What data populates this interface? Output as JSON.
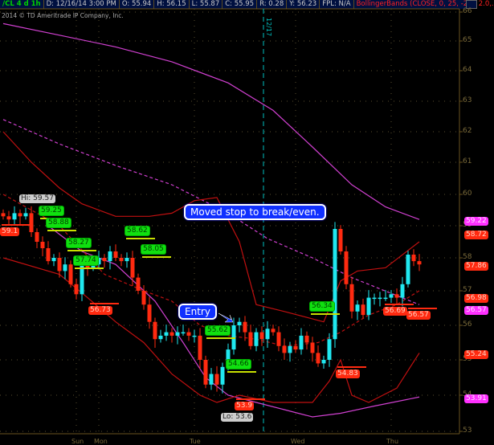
{
  "header": {
    "symbol": "/CL 4 d 1h",
    "date": "D: 12/16/14 3:00 PM",
    "open": "O: 55.94",
    "high": "H: 56.15",
    "low": "L: 55.87",
    "close": "C: 55.95",
    "range": "R: 0.28",
    "y": "Y: 56.23",
    "fpl": "FPL: N/A",
    "study": "BollingerBands (CLOSE, 0, 25, -2.0, 2.0,..."
  },
  "copyright": "2014 © TD Ameritrade IP Company, Inc.",
  "vline_label": "12/17",
  "chart_data": {
    "type": "candlestick",
    "yticks": [
      {
        "v": "66"
      },
      {
        "v": "65"
      },
      {
        "v": "64"
      },
      {
        "v": "63"
      },
      {
        "v": "62"
      },
      {
        "v": "61"
      },
      {
        "v": "60"
      },
      {
        "v": "59"
      },
      {
        "v": "58"
      },
      {
        "v": "57"
      },
      {
        "v": "56"
      },
      {
        "v": "55"
      },
      {
        "v": "54"
      },
      {
        "v": "53"
      }
    ],
    "days": [
      {
        "label": "Sun",
        "i": 13
      },
      {
        "label": "Mon",
        "i": 17
      },
      {
        "label": "Tue",
        "i": 34
      },
      {
        "label": "Wed",
        "i": 52
      },
      {
        "label": "Thu",
        "i": 69
      }
    ],
    "first_open": 59.4,
    "closes": [
      59.3,
      59.2,
      59.4,
      59.3,
      59.4,
      58.8,
      58.5,
      58.3,
      57.9,
      58.0,
      57.6,
      57.8,
      57.2,
      56.9,
      57.8,
      57.7,
      57.8,
      58.0,
      57.9,
      58.2,
      58.0,
      57.9,
      58.0,
      57.4,
      57.0,
      56.6,
      56.1,
      55.6,
      55.7,
      55.8,
      55.7,
      55.8,
      55.8,
      55.7,
      55.7,
      55.0,
      54.3,
      54.6,
      54.3,
      54.8,
      55.3,
      56.0,
      56.1,
      55.8,
      55.4,
      55.8,
      55.6,
      55.9,
      55.8,
      55.4,
      55.2,
      55.4,
      55.3,
      55.7,
      55.5,
      55.2,
      54.9,
      55.0,
      55.6,
      58.9,
      58.2,
      57.2,
      56.4,
      56.6,
      56.3,
      56.8,
      56.8,
      56.8,
      56.8,
      56.9,
      56.8,
      57.2,
      58.1,
      57.9,
      57.8
    ],
    "lines": [
      {
        "name": "magenta-upper",
        "color": "#d040d0",
        "dash": false,
        "pts": [
          [
            0,
            65.6
          ],
          [
            10,
            65.2
          ],
          [
            20,
            64.8
          ],
          [
            30,
            64.3
          ],
          [
            40,
            63.6
          ],
          [
            48,
            62.7
          ],
          [
            55,
            61.5
          ],
          [
            62,
            60.3
          ],
          [
            68,
            59.6
          ],
          [
            74,
            59.2
          ]
        ]
      },
      {
        "name": "magenta-mid",
        "color": "#d040d0",
        "dash": true,
        "pts": [
          [
            0,
            62.4
          ],
          [
            10,
            61.6
          ],
          [
            20,
            60.9
          ],
          [
            30,
            60.3
          ],
          [
            40,
            59.4
          ],
          [
            47,
            58.6
          ],
          [
            55,
            58.0
          ],
          [
            62,
            57.4
          ],
          [
            74,
            56.6
          ]
        ]
      },
      {
        "name": "magenta-lower",
        "color": "#d040d0",
        "dash": false,
        "pts": [
          [
            8,
            59.0
          ],
          [
            14,
            58.2
          ],
          [
            20,
            57.8
          ],
          [
            27,
            56.7
          ],
          [
            32,
            55.5
          ],
          [
            36,
            54.5
          ],
          [
            40,
            54.0
          ],
          [
            45,
            53.8
          ],
          [
            50,
            53.6
          ],
          [
            55,
            53.4
          ],
          [
            60,
            53.5
          ],
          [
            66,
            53.7
          ],
          [
            74,
            53.95
          ]
        ]
      },
      {
        "name": "bb-upper",
        "color": "#c01010",
        "dash": false,
        "pts": [
          [
            0,
            62.0
          ],
          [
            5,
            61.0
          ],
          [
            10,
            60.2
          ],
          [
            14,
            59.7
          ],
          [
            20,
            59.3
          ],
          [
            26,
            59.3
          ],
          [
            30,
            59.4
          ],
          [
            34,
            59.8
          ],
          [
            38,
            59.9
          ],
          [
            42,
            58.5
          ],
          [
            45,
            56.6
          ],
          [
            50,
            56.4
          ],
          [
            57,
            56.1
          ],
          [
            60,
            57.3
          ],
          [
            63,
            57.6
          ],
          [
            68,
            57.7
          ],
          [
            74,
            58.5
          ]
        ]
      },
      {
        "name": "bb-mid",
        "color": "#c01010",
        "dash": true,
        "pts": [
          [
            0,
            60.0
          ],
          [
            10,
            59.0
          ],
          [
            18,
            57.5
          ],
          [
            25,
            57.0
          ],
          [
            30,
            56.7
          ],
          [
            35,
            56.0
          ],
          [
            40,
            55.7
          ],
          [
            45,
            55.6
          ],
          [
            50,
            55.4
          ],
          [
            56,
            55.5
          ],
          [
            60,
            55.8
          ],
          [
            65,
            56.3
          ],
          [
            70,
            56.6
          ],
          [
            74,
            57.0
          ]
        ]
      },
      {
        "name": "bb-lower",
        "color": "#c01010",
        "dash": false,
        "pts": [
          [
            0,
            58.0
          ],
          [
            10,
            57.5
          ],
          [
            15,
            56.8
          ],
          [
            20,
            56.1
          ],
          [
            25,
            55.5
          ],
          [
            30,
            54.6
          ],
          [
            35,
            54.0
          ],
          [
            38,
            53.8
          ],
          [
            42,
            54.0
          ],
          [
            48,
            53.8
          ],
          [
            55,
            53.8
          ],
          [
            58,
            54.4
          ],
          [
            60,
            55.0
          ],
          [
            62,
            54.0
          ],
          [
            65,
            53.8
          ],
          [
            70,
            54.2
          ],
          [
            74,
            55.2
          ]
        ]
      }
    ]
  },
  "price_labels": [
    {
      "text": "59.25",
      "kind": "g"
    },
    {
      "text": "58.88",
      "kind": "g"
    },
    {
      "text": "58.27",
      "kind": "g"
    },
    {
      "text": "57.74",
      "kind": "g"
    },
    {
      "text": "58.62",
      "kind": "g"
    },
    {
      "text": "58.05",
      "kind": "g"
    },
    {
      "text": "55.62",
      "kind": "g"
    },
    {
      "text": "54.66",
      "kind": "g"
    },
    {
      "text": "56.34",
      "kind": "g"
    },
    {
      "text": "59.1",
      "kind": "r"
    },
    {
      "text": "56.73",
      "kind": "r"
    },
    {
      "text": "53.9",
      "kind": "r"
    },
    {
      "text": "54.83",
      "kind": "r"
    },
    {
      "text": "56.69",
      "kind": "r"
    },
    {
      "text": "56.57",
      "kind": "r"
    },
    {
      "text": "Hi: 59.57",
      "kind": "w"
    },
    {
      "text": "Lo: 53.6",
      "kind": "w"
    }
  ],
  "axis_labels": [
    {
      "text": "59.22",
      "kind": "m"
    },
    {
      "text": "58.72",
      "kind": "r"
    },
    {
      "text": "57.86",
      "kind": "r"
    },
    {
      "text": "56.98",
      "kind": "r"
    },
    {
      "text": "56.57",
      "kind": "m"
    },
    {
      "text": "55.24",
      "kind": "r"
    },
    {
      "text": "53.91",
      "kind": "m"
    }
  ],
  "callouts": {
    "stop": "Moved stop to break/even.",
    "entry": "Entry"
  }
}
